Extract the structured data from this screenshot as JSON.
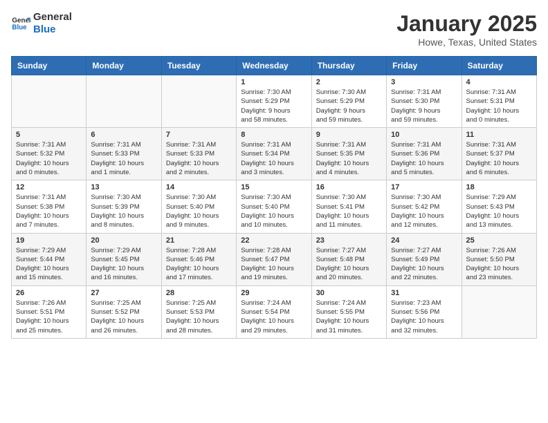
{
  "header": {
    "logo_line1": "General",
    "logo_line2": "Blue",
    "month_title": "January 2025",
    "location": "Howe, Texas, United States"
  },
  "weekdays": [
    "Sunday",
    "Monday",
    "Tuesday",
    "Wednesday",
    "Thursday",
    "Friday",
    "Saturday"
  ],
  "weeks": [
    [
      {
        "day": "",
        "info": ""
      },
      {
        "day": "",
        "info": ""
      },
      {
        "day": "",
        "info": ""
      },
      {
        "day": "1",
        "info": "Sunrise: 7:30 AM\nSunset: 5:29 PM\nDaylight: 9 hours\nand 58 minutes."
      },
      {
        "day": "2",
        "info": "Sunrise: 7:30 AM\nSunset: 5:29 PM\nDaylight: 9 hours\nand 59 minutes."
      },
      {
        "day": "3",
        "info": "Sunrise: 7:31 AM\nSunset: 5:30 PM\nDaylight: 9 hours\nand 59 minutes."
      },
      {
        "day": "4",
        "info": "Sunrise: 7:31 AM\nSunset: 5:31 PM\nDaylight: 10 hours\nand 0 minutes."
      }
    ],
    [
      {
        "day": "5",
        "info": "Sunrise: 7:31 AM\nSunset: 5:32 PM\nDaylight: 10 hours\nand 0 minutes."
      },
      {
        "day": "6",
        "info": "Sunrise: 7:31 AM\nSunset: 5:33 PM\nDaylight: 10 hours\nand 1 minute."
      },
      {
        "day": "7",
        "info": "Sunrise: 7:31 AM\nSunset: 5:33 PM\nDaylight: 10 hours\nand 2 minutes."
      },
      {
        "day": "8",
        "info": "Sunrise: 7:31 AM\nSunset: 5:34 PM\nDaylight: 10 hours\nand 3 minutes."
      },
      {
        "day": "9",
        "info": "Sunrise: 7:31 AM\nSunset: 5:35 PM\nDaylight: 10 hours\nand 4 minutes."
      },
      {
        "day": "10",
        "info": "Sunrise: 7:31 AM\nSunset: 5:36 PM\nDaylight: 10 hours\nand 5 minutes."
      },
      {
        "day": "11",
        "info": "Sunrise: 7:31 AM\nSunset: 5:37 PM\nDaylight: 10 hours\nand 6 minutes."
      }
    ],
    [
      {
        "day": "12",
        "info": "Sunrise: 7:31 AM\nSunset: 5:38 PM\nDaylight: 10 hours\nand 7 minutes."
      },
      {
        "day": "13",
        "info": "Sunrise: 7:30 AM\nSunset: 5:39 PM\nDaylight: 10 hours\nand 8 minutes."
      },
      {
        "day": "14",
        "info": "Sunrise: 7:30 AM\nSunset: 5:40 PM\nDaylight: 10 hours\nand 9 minutes."
      },
      {
        "day": "15",
        "info": "Sunrise: 7:30 AM\nSunset: 5:40 PM\nDaylight: 10 hours\nand 10 minutes."
      },
      {
        "day": "16",
        "info": "Sunrise: 7:30 AM\nSunset: 5:41 PM\nDaylight: 10 hours\nand 11 minutes."
      },
      {
        "day": "17",
        "info": "Sunrise: 7:30 AM\nSunset: 5:42 PM\nDaylight: 10 hours\nand 12 minutes."
      },
      {
        "day": "18",
        "info": "Sunrise: 7:29 AM\nSunset: 5:43 PM\nDaylight: 10 hours\nand 13 minutes."
      }
    ],
    [
      {
        "day": "19",
        "info": "Sunrise: 7:29 AM\nSunset: 5:44 PM\nDaylight: 10 hours\nand 15 minutes."
      },
      {
        "day": "20",
        "info": "Sunrise: 7:29 AM\nSunset: 5:45 PM\nDaylight: 10 hours\nand 16 minutes."
      },
      {
        "day": "21",
        "info": "Sunrise: 7:28 AM\nSunset: 5:46 PM\nDaylight: 10 hours\nand 17 minutes."
      },
      {
        "day": "22",
        "info": "Sunrise: 7:28 AM\nSunset: 5:47 PM\nDaylight: 10 hours\nand 19 minutes."
      },
      {
        "day": "23",
        "info": "Sunrise: 7:27 AM\nSunset: 5:48 PM\nDaylight: 10 hours\nand 20 minutes."
      },
      {
        "day": "24",
        "info": "Sunrise: 7:27 AM\nSunset: 5:49 PM\nDaylight: 10 hours\nand 22 minutes."
      },
      {
        "day": "25",
        "info": "Sunrise: 7:26 AM\nSunset: 5:50 PM\nDaylight: 10 hours\nand 23 minutes."
      }
    ],
    [
      {
        "day": "26",
        "info": "Sunrise: 7:26 AM\nSunset: 5:51 PM\nDaylight: 10 hours\nand 25 minutes."
      },
      {
        "day": "27",
        "info": "Sunrise: 7:25 AM\nSunset: 5:52 PM\nDaylight: 10 hours\nand 26 minutes."
      },
      {
        "day": "28",
        "info": "Sunrise: 7:25 AM\nSunset: 5:53 PM\nDaylight: 10 hours\nand 28 minutes."
      },
      {
        "day": "29",
        "info": "Sunrise: 7:24 AM\nSunset: 5:54 PM\nDaylight: 10 hours\nand 29 minutes."
      },
      {
        "day": "30",
        "info": "Sunrise: 7:24 AM\nSunset: 5:55 PM\nDaylight: 10 hours\nand 31 minutes."
      },
      {
        "day": "31",
        "info": "Sunrise: 7:23 AM\nSunset: 5:56 PM\nDaylight: 10 hours\nand 32 minutes."
      },
      {
        "day": "",
        "info": ""
      }
    ]
  ]
}
